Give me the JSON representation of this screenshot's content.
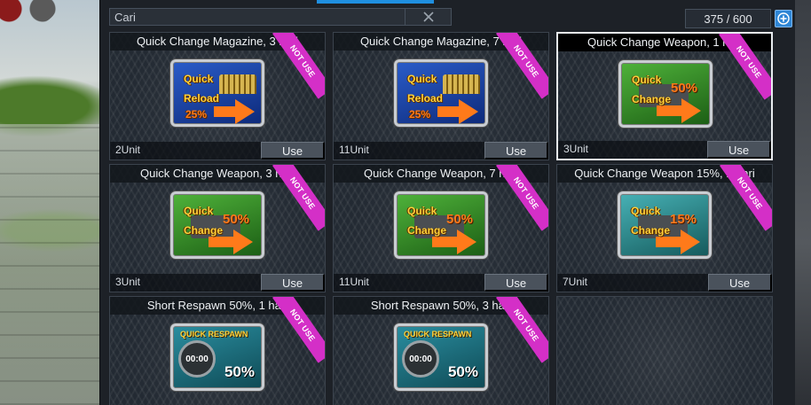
{
  "search": {
    "placeholder": "Cari"
  },
  "inventory": {
    "count": "375 / 600"
  },
  "items": [
    {
      "title": "Quick Change Magazine, 3 hari",
      "units": "2Unit",
      "use_label": "Use",
      "badge": "NOT USE",
      "icon": "quick-reload-icon",
      "icon_lines": [
        "Quick",
        "Reload",
        "25%"
      ]
    },
    {
      "title": "Quick Change Magazine, 7 hari",
      "units": "11Unit",
      "use_label": "Use",
      "badge": "NOT USE",
      "icon": "quick-reload-icon",
      "icon_lines": [
        "Quick",
        "Reload",
        "25%"
      ]
    },
    {
      "title": "Quick Change Weapon, 1 hari",
      "units": "3Unit",
      "use_label": "Use",
      "badge": "NOT USE",
      "icon": "quick-change-icon",
      "icon_lines": [
        "Quick",
        "Change",
        "50%"
      ],
      "selected": true
    },
    {
      "title": "Quick Change Weapon, 3 hari",
      "units": "3Unit",
      "use_label": "Use",
      "badge": "NOT USE",
      "icon": "quick-change-icon",
      "icon_lines": [
        "Quick",
        "Change",
        "50%"
      ]
    },
    {
      "title": "Quick Change Weapon, 7 hari",
      "units": "11Unit",
      "use_label": "Use",
      "badge": "NOT USE",
      "icon": "quick-change-icon",
      "icon_lines": [
        "Quick",
        "Change",
        "50%"
      ]
    },
    {
      "title": "Quick Change Weapon 15%, 1 hari",
      "units": "7Unit",
      "use_label": "Use",
      "badge": "NOT USE",
      "icon": "quick-change-icon",
      "icon_lines": [
        "Quick",
        "Change",
        "15%"
      ]
    },
    {
      "title": "Short Respawn 50%, 1 hari",
      "badge": "NOT USE",
      "icon": "quick-respawn-icon",
      "icon_lines": [
        "QUICK RESPAWN",
        "00:00",
        "50%"
      ]
    },
    {
      "title": "Short Respawn 50%, 3 hari",
      "badge": "NOT USE",
      "icon": "quick-respawn-icon",
      "icon_lines": [
        "QUICK RESPAWN",
        "00:00",
        "50%"
      ]
    }
  ],
  "colors": {
    "accent": "#1f8fe0",
    "badge": "#d42fc7",
    "panel": "#1d2127"
  }
}
